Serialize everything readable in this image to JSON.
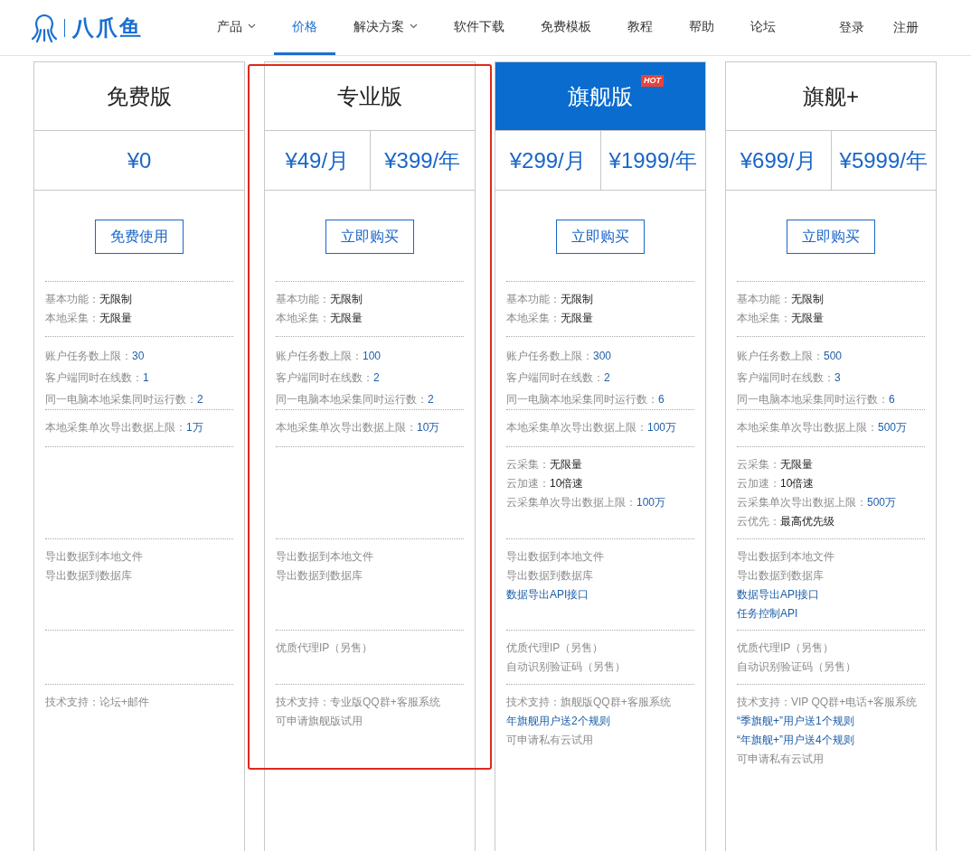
{
  "logo": {
    "text": "八爪鱼"
  },
  "nav": [
    {
      "label": "产品",
      "dropdown": true,
      "selected": false
    },
    {
      "label": "价格",
      "dropdown": false,
      "selected": true
    },
    {
      "label": "解决方案",
      "dropdown": true,
      "selected": false
    },
    {
      "label": "软件下载",
      "dropdown": false,
      "selected": false
    },
    {
      "label": "免费模板",
      "dropdown": false,
      "selected": false
    },
    {
      "label": "教程",
      "dropdown": false,
      "selected": false
    },
    {
      "label": "帮助",
      "dropdown": false,
      "selected": false
    },
    {
      "label": "论坛",
      "dropdown": false,
      "selected": false
    }
  ],
  "account_links": [
    "登录",
    "注册"
  ],
  "plans": [
    {
      "name": "免费版",
      "featured": false,
      "outlined": false,
      "prices": [
        "¥0"
      ],
      "button": "免费使用",
      "sections": [
        {
          "kind": "basic",
          "lines": [
            {
              "kind": "pair",
              "label": "基本功能：",
              "value": "无限制",
              "highlighted": false
            },
            {
              "kind": "pair",
              "label": "本地采集：",
              "value": "无限量",
              "highlighted": false
            }
          ]
        },
        {
          "kind": "limits",
          "lines": [
            {
              "kind": "pair",
              "label": "账户任务数上限：",
              "value": "30",
              "highlighted": true
            },
            {
              "kind": "pair",
              "label": "客户端同时在线数：",
              "value": "1",
              "highlighted": true
            },
            {
              "kind": "pair",
              "label": "同一电脑本地采集同时运行数：",
              "value": "2",
              "highlighted": true
            }
          ]
        },
        {
          "kind": "export_limit",
          "lines": [
            {
              "kind": "pair",
              "label": "本地采集单次导出数据上限：",
              "value": "1万",
              "highlighted": true
            }
          ]
        },
        {
          "kind": "export",
          "lines": [
            {
              "kind": "note",
              "text": "导出数据到本地文件",
              "highlighted": false
            },
            {
              "kind": "note",
              "text": "导出数据到数据库",
              "highlighted": false
            }
          ]
        },
        {
          "kind": "support",
          "lines": [
            {
              "kind": "note",
              "text": "技术支持：论坛+邮件",
              "highlighted": false
            }
          ]
        }
      ]
    },
    {
      "name": "专业版",
      "featured": false,
      "outlined": true,
      "prices": [
        "¥49/月",
        "¥399/年"
      ],
      "button": "立即购买",
      "sections": [
        {
          "kind": "basic",
          "lines": [
            {
              "kind": "pair",
              "label": "基本功能：",
              "value": "无限制",
              "highlighted": false
            },
            {
              "kind": "pair",
              "label": "本地采集：",
              "value": "无限量",
              "highlighted": false
            }
          ]
        },
        {
          "kind": "limits",
          "lines": [
            {
              "kind": "pair",
              "label": "账户任务数上限：",
              "value": "100",
              "highlighted": true
            },
            {
              "kind": "pair",
              "label": "客户端同时在线数：",
              "value": "2",
              "highlighted": true
            },
            {
              "kind": "pair",
              "label": "同一电脑本地采集同时运行数：",
              "value": "2",
              "highlighted": true
            }
          ]
        },
        {
          "kind": "export_limit",
          "lines": [
            {
              "kind": "pair",
              "label": "本地采集单次导出数据上限：",
              "value": "10万",
              "highlighted": true
            }
          ]
        },
        {
          "kind": "export",
          "lines": [
            {
              "kind": "note",
              "text": "导出数据到本地文件",
              "highlighted": false
            },
            {
              "kind": "note",
              "text": "导出数据到数据库",
              "highlighted": false
            }
          ]
        },
        {
          "kind": "addons",
          "lines": [
            {
              "kind": "note",
              "text": "优质代理IP（另售）",
              "highlighted": false
            }
          ]
        },
        {
          "kind": "support",
          "lines": [
            {
              "kind": "note",
              "text": "技术支持：专业版QQ群+客服系统",
              "highlighted": false
            },
            {
              "kind": "note",
              "text": "可申请旗舰版试用",
              "highlighted": false
            }
          ]
        }
      ]
    },
    {
      "name": "旗舰版",
      "featured": true,
      "outlined": false,
      "badge": "HOT",
      "prices": [
        "¥299/月",
        "¥1999/年"
      ],
      "button": "立即购买",
      "sections": [
        {
          "kind": "basic",
          "lines": [
            {
              "kind": "pair",
              "label": "基本功能：",
              "value": "无限制",
              "highlighted": false
            },
            {
              "kind": "pair",
              "label": "本地采集：",
              "value": "无限量",
              "highlighted": false
            }
          ]
        },
        {
          "kind": "limits",
          "lines": [
            {
              "kind": "pair",
              "label": "账户任务数上限：",
              "value": "300",
              "highlighted": true
            },
            {
              "kind": "pair",
              "label": "客户端同时在线数：",
              "value": "2",
              "highlighted": true
            },
            {
              "kind": "pair",
              "label": "同一电脑本地采集同时运行数：",
              "value": "6",
              "highlighted": true
            }
          ]
        },
        {
          "kind": "export_limit",
          "lines": [
            {
              "kind": "pair",
              "label": "本地采集单次导出数据上限：",
              "value": "100万",
              "highlighted": true
            }
          ]
        },
        {
          "kind": "cloud",
          "lines": [
            {
              "kind": "pair",
              "label": "云采集：",
              "value": "无限量",
              "highlighted": false
            },
            {
              "kind": "pair",
              "label": "云加速：",
              "value": "10倍速",
              "highlighted": false
            },
            {
              "kind": "pair",
              "label": "云采集单次导出数据上限：",
              "value": "100万",
              "highlighted": true
            }
          ]
        },
        {
          "kind": "export",
          "lines": [
            {
              "kind": "note",
              "text": "导出数据到本地文件",
              "highlighted": false
            },
            {
              "kind": "note",
              "text": "导出数据到数据库",
              "highlighted": false
            },
            {
              "kind": "note",
              "text": "数据导出API接口",
              "highlighted": true
            }
          ]
        },
        {
          "kind": "addons",
          "lines": [
            {
              "kind": "note",
              "text": "优质代理IP（另售）",
              "highlighted": false
            },
            {
              "kind": "note",
              "text": "自动识别验证码（另售）",
              "highlighted": false
            }
          ]
        },
        {
          "kind": "support",
          "lines": [
            {
              "kind": "note",
              "text": "技术支持：旗舰版QQ群+客服系统",
              "highlighted": false
            },
            {
              "kind": "note",
              "text": "年旗舰用户送2个规则",
              "highlighted": true
            },
            {
              "kind": "note",
              "text": "可申请私有云试用",
              "highlighted": false
            }
          ]
        }
      ]
    },
    {
      "name": "旗舰+",
      "featured": false,
      "outlined": false,
      "prices": [
        "¥699/月",
        "¥5999/年"
      ],
      "button": "立即购买",
      "sections": [
        {
          "kind": "basic",
          "lines": [
            {
              "kind": "pair",
              "label": "基本功能：",
              "value": "无限制",
              "highlighted": false
            },
            {
              "kind": "pair",
              "label": "本地采集：",
              "value": "无限量",
              "highlighted": false
            }
          ]
        },
        {
          "kind": "limits",
          "lines": [
            {
              "kind": "pair",
              "label": "账户任务数上限：",
              "value": "500",
              "highlighted": true
            },
            {
              "kind": "pair",
              "label": "客户端同时在线数：",
              "value": "3",
              "highlighted": true
            },
            {
              "kind": "pair",
              "label": "同一电脑本地采集同时运行数：",
              "value": "6",
              "highlighted": true
            }
          ]
        },
        {
          "kind": "export_limit",
          "lines": [
            {
              "kind": "pair",
              "label": "本地采集单次导出数据上限：",
              "value": "500万",
              "highlighted": true
            }
          ]
        },
        {
          "kind": "cloud",
          "lines": [
            {
              "kind": "pair",
              "label": "云采集：",
              "value": "无限量",
              "highlighted": false
            },
            {
              "kind": "pair",
              "label": "云加速：",
              "value": "10倍速",
              "highlighted": false
            },
            {
              "kind": "pair",
              "label": "云采集单次导出数据上限：",
              "value": "500万",
              "highlighted": true
            },
            {
              "kind": "pair",
              "label": "云优先：",
              "value": "最高优先级",
              "highlighted": false
            }
          ]
        },
        {
          "kind": "export",
          "lines": [
            {
              "kind": "note",
              "text": "导出数据到本地文件",
              "highlighted": false
            },
            {
              "kind": "note",
              "text": "导出数据到数据库",
              "highlighted": false
            },
            {
              "kind": "note",
              "text": "数据导出API接口",
              "highlighted": true
            },
            {
              "kind": "note",
              "text": "任务控制API",
              "highlighted": true
            }
          ]
        },
        {
          "kind": "addons",
          "lines": [
            {
              "kind": "note",
              "text": "优质代理IP（另售）",
              "highlighted": false
            },
            {
              "kind": "note",
              "text": "自动识别验证码（另售）",
              "highlighted": false
            }
          ]
        },
        {
          "kind": "support",
          "lines": [
            {
              "kind": "note",
              "text": "技术支持：VIP QQ群+电话+客服系统",
              "highlighted": false
            },
            {
              "kind": "note",
              "text": "“季旗舰+”用户送1个规则",
              "highlighted": true
            },
            {
              "kind": "note",
              "text": "“年旗舰+”用户送4个规则",
              "highlighted": true
            },
            {
              "kind": "note",
              "text": "可申请私有云试用",
              "highlighted": false
            }
          ]
        }
      ]
    }
  ]
}
